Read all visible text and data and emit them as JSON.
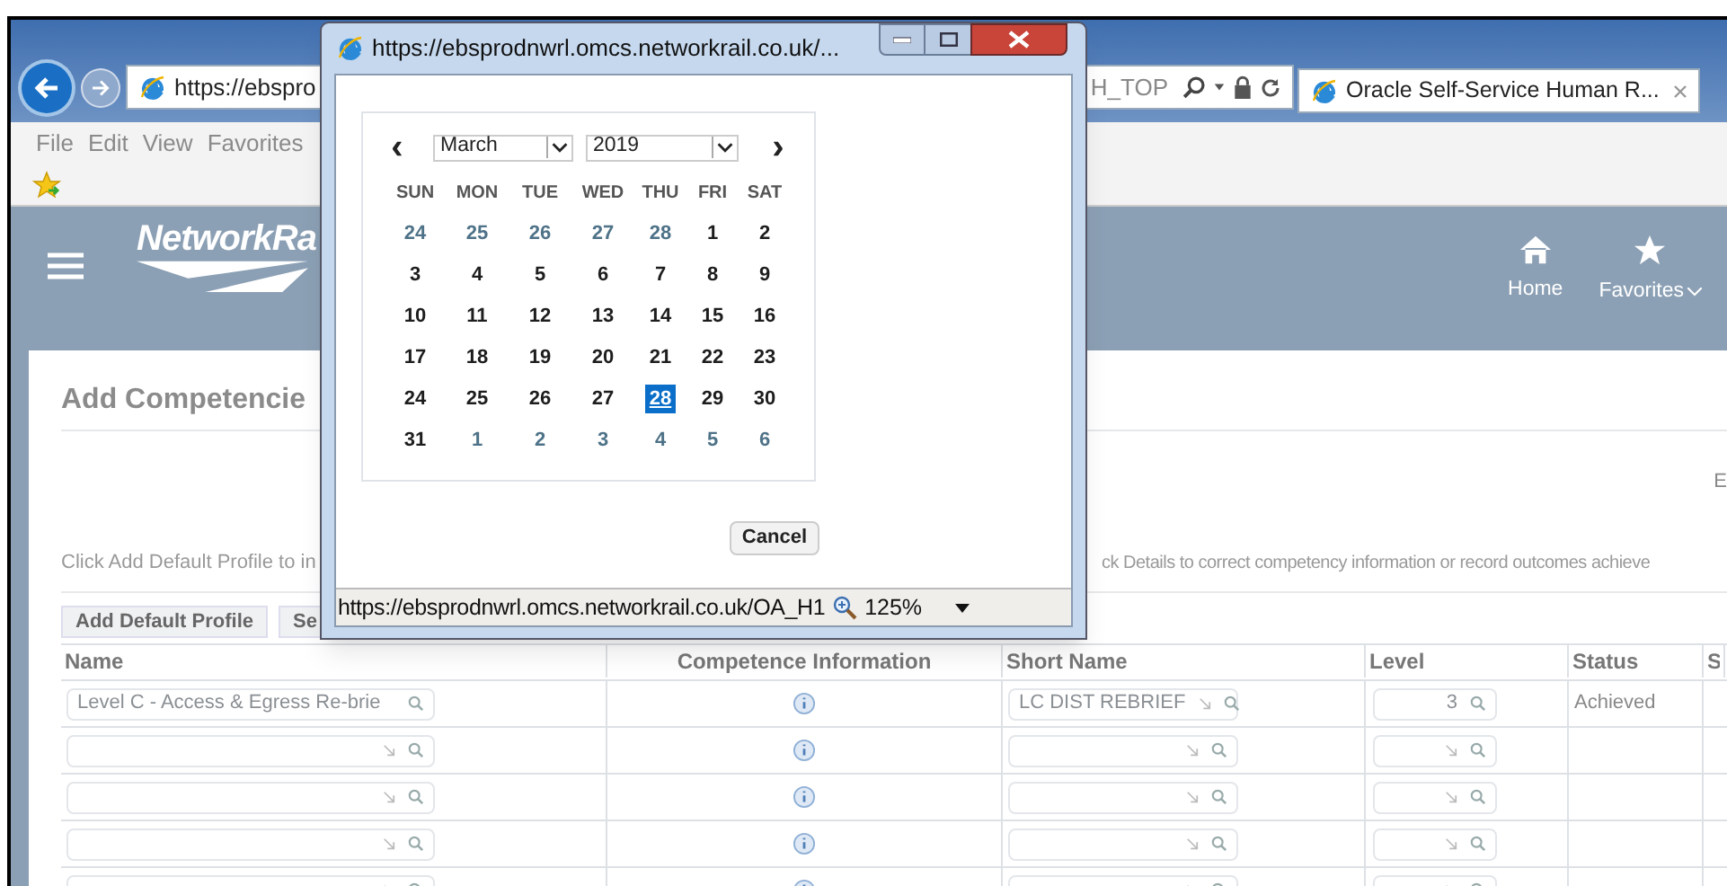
{
  "browser": {
    "url_start": "https://ebspro",
    "url_end": "H_TOP",
    "tab": {
      "title": "Oracle Self-Service Human R...",
      "selected": true
    },
    "menu": [
      "File",
      "Edit",
      "View",
      "Favorites"
    ]
  },
  "app_header": {
    "logo": "NetworkRa",
    "nav": [
      {
        "label": "Home",
        "kind": "home"
      },
      {
        "label": "Favorites",
        "kind": "favorites"
      }
    ]
  },
  "page": {
    "title": "Add Competencie",
    "right_mark": "E",
    "instruction_left": "Click Add Default Profile to in",
    "instruction_right": "ck Details to correct competency information or record outcomes achieve",
    "buttons": [
      "Add Default Profile",
      "Se"
    ],
    "table": {
      "columns": [
        "Name",
        "Competence Information",
        "Short Name",
        "Level",
        "Status",
        "S"
      ],
      "rows": [
        {
          "name": "Level C - Access & Egress Re-brie",
          "short_name": "LC DIST REBRIEF",
          "level": "3",
          "status": "Achieved"
        },
        {},
        {},
        {},
        {}
      ]
    }
  },
  "popup": {
    "title": "https://ebsprodnwrl.omcs.networkrail.co.uk/...",
    "calendar": {
      "month": "March",
      "year": "2019",
      "prev": "‹",
      "next": "›",
      "weekdays": [
        "SUN",
        "MON",
        "TUE",
        "WED",
        "THU",
        "FRI",
        "SAT"
      ],
      "days": [
        {
          "label": "24",
          "in_month": false,
          "selected": false
        },
        {
          "label": "25",
          "in_month": false,
          "selected": false
        },
        {
          "label": "26",
          "in_month": false,
          "selected": false
        },
        {
          "label": "27",
          "in_month": false,
          "selected": false
        },
        {
          "label": "28",
          "in_month": false,
          "selected": false
        },
        {
          "label": "1",
          "in_month": true,
          "selected": false
        },
        {
          "label": "2",
          "in_month": true,
          "selected": false
        },
        {
          "label": "3",
          "in_month": true,
          "selected": false
        },
        {
          "label": "4",
          "in_month": true,
          "selected": false
        },
        {
          "label": "5",
          "in_month": true,
          "selected": false
        },
        {
          "label": "6",
          "in_month": true,
          "selected": false
        },
        {
          "label": "7",
          "in_month": true,
          "selected": false
        },
        {
          "label": "8",
          "in_month": true,
          "selected": false
        },
        {
          "label": "9",
          "in_month": true,
          "selected": false
        },
        {
          "label": "10",
          "in_month": true,
          "selected": false
        },
        {
          "label": "11",
          "in_month": true,
          "selected": false
        },
        {
          "label": "12",
          "in_month": true,
          "selected": false
        },
        {
          "label": "13",
          "in_month": true,
          "selected": false
        },
        {
          "label": "14",
          "in_month": true,
          "selected": false
        },
        {
          "label": "15",
          "in_month": true,
          "selected": false
        },
        {
          "label": "16",
          "in_month": true,
          "selected": false
        },
        {
          "label": "17",
          "in_month": true,
          "selected": false
        },
        {
          "label": "18",
          "in_month": true,
          "selected": false
        },
        {
          "label": "19",
          "in_month": true,
          "selected": false
        },
        {
          "label": "20",
          "in_month": true,
          "selected": false
        },
        {
          "label": "21",
          "in_month": true,
          "selected": false
        },
        {
          "label": "22",
          "in_month": true,
          "selected": false
        },
        {
          "label": "23",
          "in_month": true,
          "selected": false
        },
        {
          "label": "24",
          "in_month": true,
          "selected": false
        },
        {
          "label": "25",
          "in_month": true,
          "selected": false
        },
        {
          "label": "26",
          "in_month": true,
          "selected": false
        },
        {
          "label": "27",
          "in_month": true,
          "selected": false
        },
        {
          "label": "28",
          "in_month": true,
          "selected": true
        },
        {
          "label": "29",
          "in_month": true,
          "selected": false
        },
        {
          "label": "30",
          "in_month": true,
          "selected": false
        },
        {
          "label": "31",
          "in_month": true,
          "selected": false
        },
        {
          "label": "1",
          "in_month": false,
          "selected": false
        },
        {
          "label": "2",
          "in_month": false,
          "selected": false
        },
        {
          "label": "3",
          "in_month": false,
          "selected": false
        },
        {
          "label": "4",
          "in_month": false,
          "selected": false
        },
        {
          "label": "5",
          "in_month": false,
          "selected": false
        },
        {
          "label": "6",
          "in_month": false,
          "selected": false
        }
      ]
    },
    "cancel": "Cancel",
    "status_url": "https://ebsprodnwrl.omcs.networkrail.co.uk/OA_H1",
    "zoom": "125%"
  }
}
